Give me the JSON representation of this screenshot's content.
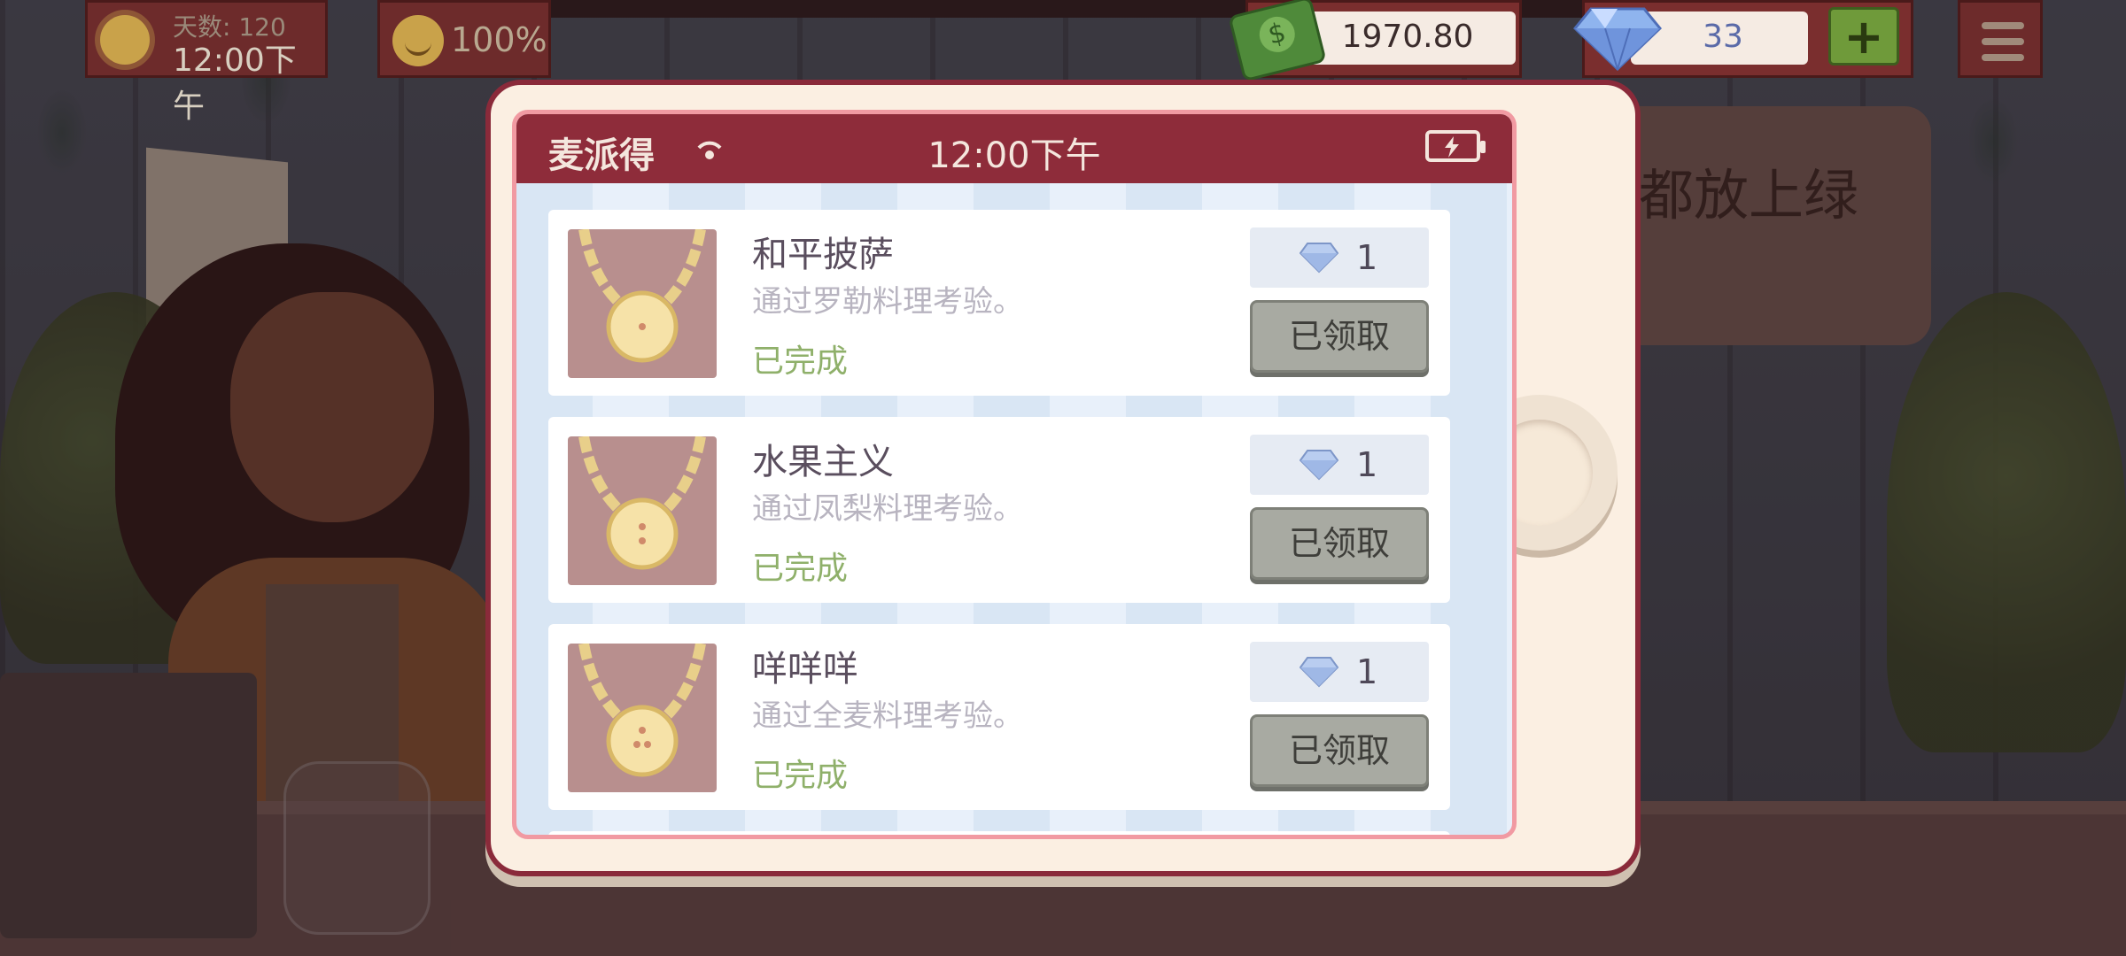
{
  "hud": {
    "day_label": "天数: 120",
    "time": "12:00下午",
    "mood_percent": "100%",
    "money": "1970.80",
    "gems": "33",
    "plus_label": "+"
  },
  "background": {
    "sign_text": "都放上绿"
  },
  "phone": {
    "carrier": "麦派得",
    "clock": "12:00下午"
  },
  "achievements": [
    {
      "title": "和平披萨",
      "description": "通过罗勒料理考验。",
      "status": "已完成",
      "reward": "1",
      "button": "已领取"
    },
    {
      "title": "水果主义",
      "description": "通过凤梨料理考验。",
      "status": "已完成",
      "reward": "1",
      "button": "已领取"
    },
    {
      "title": "咩咩咩",
      "description": "通过全麦料理考验。",
      "status": "已完成",
      "reward": "1",
      "button": "已领取"
    }
  ],
  "icons": {
    "day": "sun-icon",
    "mood": "smiley-icon",
    "money": "cash-icon",
    "gems": "diamond-icon",
    "menu": "hamburger-menu-icon",
    "signal": "signal-icon",
    "battery": "battery-charging-icon",
    "achievement": "medallion-necklace-icon"
  },
  "colors": {
    "status_bar": "#8e2c3a",
    "completed_text": "#8fb06a",
    "claimed_button": "#a8aaa2",
    "gem_text": "#5a6aa8"
  }
}
